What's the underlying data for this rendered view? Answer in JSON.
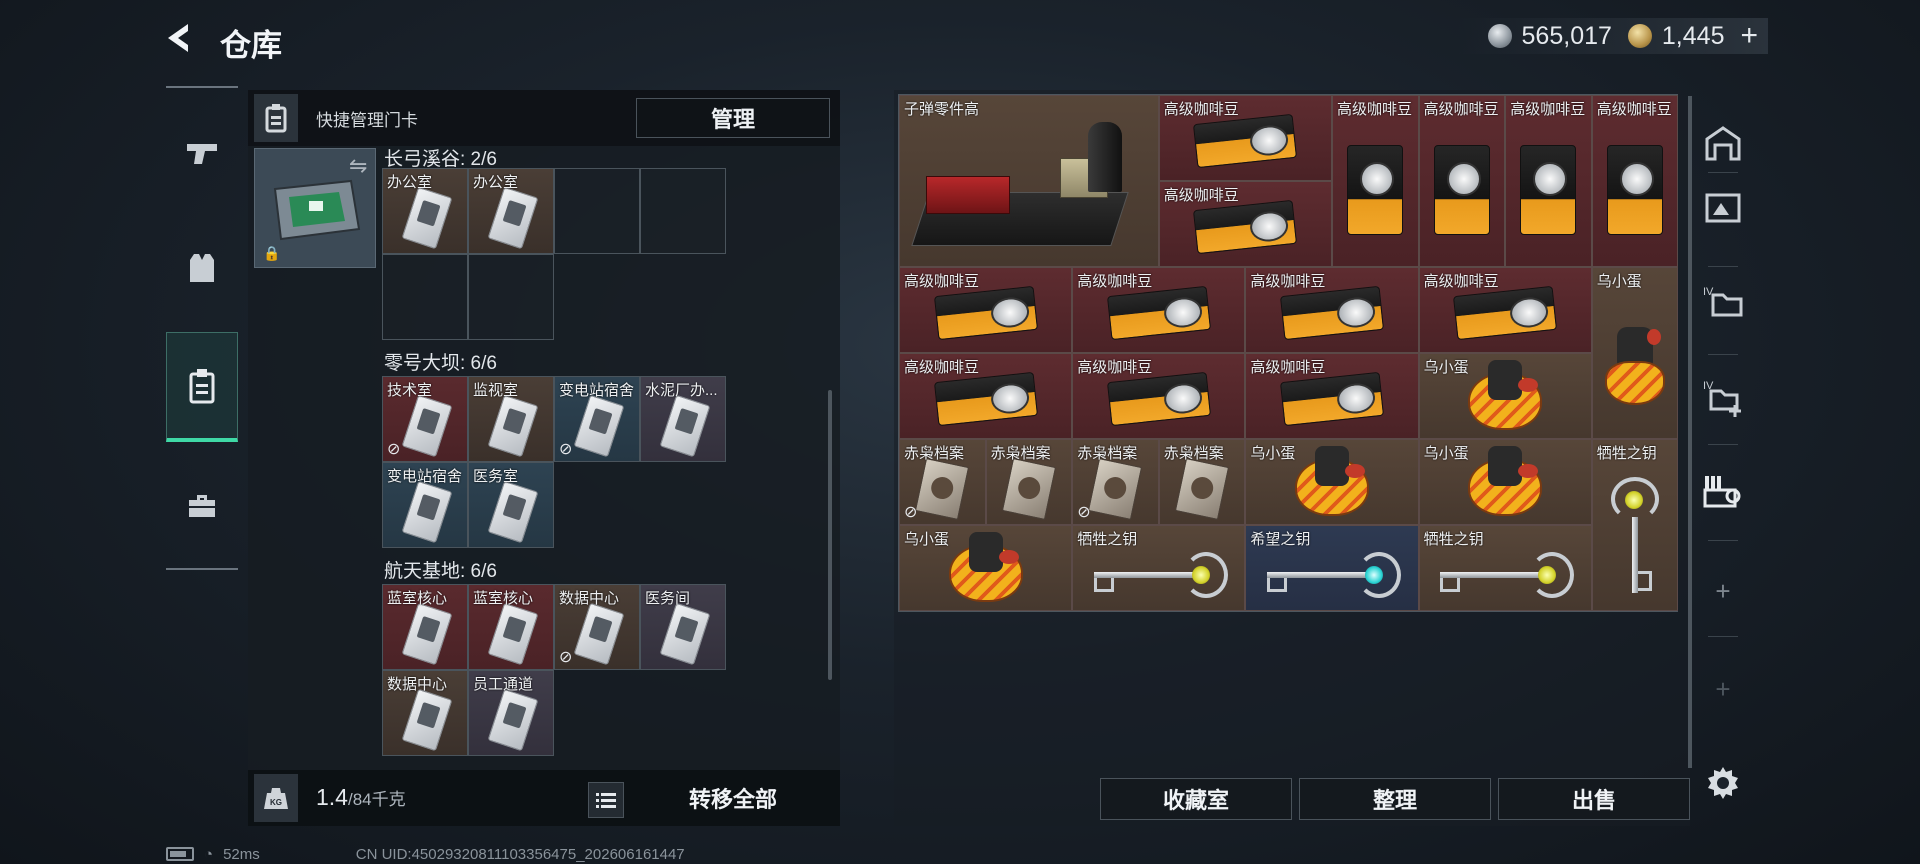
{
  "header": {
    "title": "仓库"
  },
  "currency": {
    "silver": "565,017",
    "gold": "1,445",
    "add_label": "+"
  },
  "left_panel": {
    "header_label": "快捷管理门卡",
    "manage_label": "管理",
    "sections": [
      {
        "title": "长弓溪谷: 2/6",
        "cells": [
          {
            "label": "办公室",
            "bg": "brown",
            "locked": false
          },
          {
            "label": "办公室",
            "bg": "brown",
            "locked": false
          }
        ],
        "empty_slots": 4
      },
      {
        "title": "零号大坝: 6/6",
        "cells": [
          {
            "label": "技术室",
            "bg": "red",
            "locked": true
          },
          {
            "label": "监视室",
            "bg": "brown",
            "locked": false
          },
          {
            "label": "变电站宿舍",
            "bg": "blue",
            "locked": true
          },
          {
            "label": "水泥厂办...",
            "bg": "grey",
            "locked": false
          },
          {
            "label": "变电站宿舍",
            "bg": "blue",
            "locked": false
          },
          {
            "label": "医务室",
            "bg": "blue",
            "locked": false
          }
        ],
        "empty_slots": 0
      },
      {
        "title": "航天基地: 6/6",
        "cells": [
          {
            "label": "蓝室核心",
            "bg": "red",
            "locked": false
          },
          {
            "label": "蓝室核心",
            "bg": "red",
            "locked": false
          },
          {
            "label": "数据中心",
            "bg": "brown",
            "locked": true
          },
          {
            "label": "医务间",
            "bg": "grey",
            "locked": false
          },
          {
            "label": "数据中心",
            "bg": "brown",
            "locked": false
          },
          {
            "label": "员工通道",
            "bg": "grey",
            "locked": false
          }
        ],
        "empty_slots": 0
      }
    ],
    "footer": {
      "weight_value": "1.4",
      "weight_max": "/84千克",
      "weight_icon_label": "KG",
      "transfer_label": "转移全部"
    }
  },
  "stash_items": [
    {
      "label": "子弹零件高",
      "type": "crate",
      "bg": "brown"
    },
    {
      "label": "高级咖啡豆",
      "type": "coffee-h",
      "bg": "red"
    },
    {
      "label": "高级咖啡豆",
      "type": "coffee-h",
      "bg": "red"
    },
    {
      "label": "高级咖啡豆",
      "type": "coffee-v",
      "bg": "red"
    },
    {
      "label": "高级咖啡豆",
      "type": "coffee-v",
      "bg": "red"
    },
    {
      "label": "高级咖啡豆",
      "type": "coffee-v",
      "bg": "red"
    },
    {
      "label": "高级咖啡豆",
      "type": "coffee-v",
      "bg": "red"
    },
    {
      "label": "高级咖啡豆",
      "type": "coffee-h",
      "bg": "red"
    },
    {
      "label": "高级咖啡豆",
      "type": "coffee-h",
      "bg": "red"
    },
    {
      "label": "高级咖啡豆",
      "type": "coffee-h",
      "bg": "red"
    },
    {
      "label": "高级咖啡豆",
      "type": "coffee-h",
      "bg": "red"
    },
    {
      "label": "乌小蛋",
      "type": "egg-v",
      "bg": "brown"
    },
    {
      "label": "高级咖啡豆",
      "type": "coffee-h",
      "bg": "red"
    },
    {
      "label": "高级咖啡豆",
      "type": "coffee-h",
      "bg": "red"
    },
    {
      "label": "高级咖啡豆",
      "type": "coffee-h",
      "bg": "red"
    },
    {
      "label": "乌小蛋",
      "type": "egg",
      "bg": "brown"
    },
    {
      "label": "赤枭档案",
      "type": "book",
      "bg": "brown",
      "locked": true
    },
    {
      "label": "赤枭档案",
      "type": "book",
      "bg": "brown"
    },
    {
      "label": "赤枭档案",
      "type": "book",
      "bg": "brown",
      "locked": true
    },
    {
      "label": "赤枭档案",
      "type": "book",
      "bg": "brown"
    },
    {
      "label": "乌小蛋",
      "type": "egg",
      "bg": "brown"
    },
    {
      "label": "乌小蛋",
      "type": "egg",
      "bg": "brown"
    },
    {
      "label": "牺牲之钥",
      "type": "key-v",
      "bg": "brown"
    },
    {
      "label": "乌小蛋",
      "type": "egg",
      "bg": "brown"
    },
    {
      "label": "牺牲之钥",
      "type": "key-h",
      "bg": "brown",
      "gem": "yellow"
    },
    {
      "label": "希望之钥",
      "type": "key-h",
      "bg": "blue",
      "gem": "cyan"
    },
    {
      "label": "牺牲之钥",
      "type": "key-h",
      "bg": "brown",
      "gem": "yellow"
    }
  ],
  "right_sidebar": {
    "icons": [
      "storage-unit-icon",
      "ammo-crate-icon",
      "folder-iv-icon",
      "add-folder-iv-icon",
      "keys-icon",
      "add-tab-icon",
      "add-tab-icon"
    ]
  },
  "bottom_buttons": {
    "collection": "收藏室",
    "organize": "整理",
    "sell": "出售"
  },
  "status": {
    "ping": "52ms",
    "uid": "CN UID:4502932081110335647​5_202606161447"
  },
  "colors": {
    "accent": "#3fd9a6",
    "red_bg": "#5a2a2e",
    "brown_bg": "#4a3e36",
    "blue_bg": "#2e4352"
  }
}
